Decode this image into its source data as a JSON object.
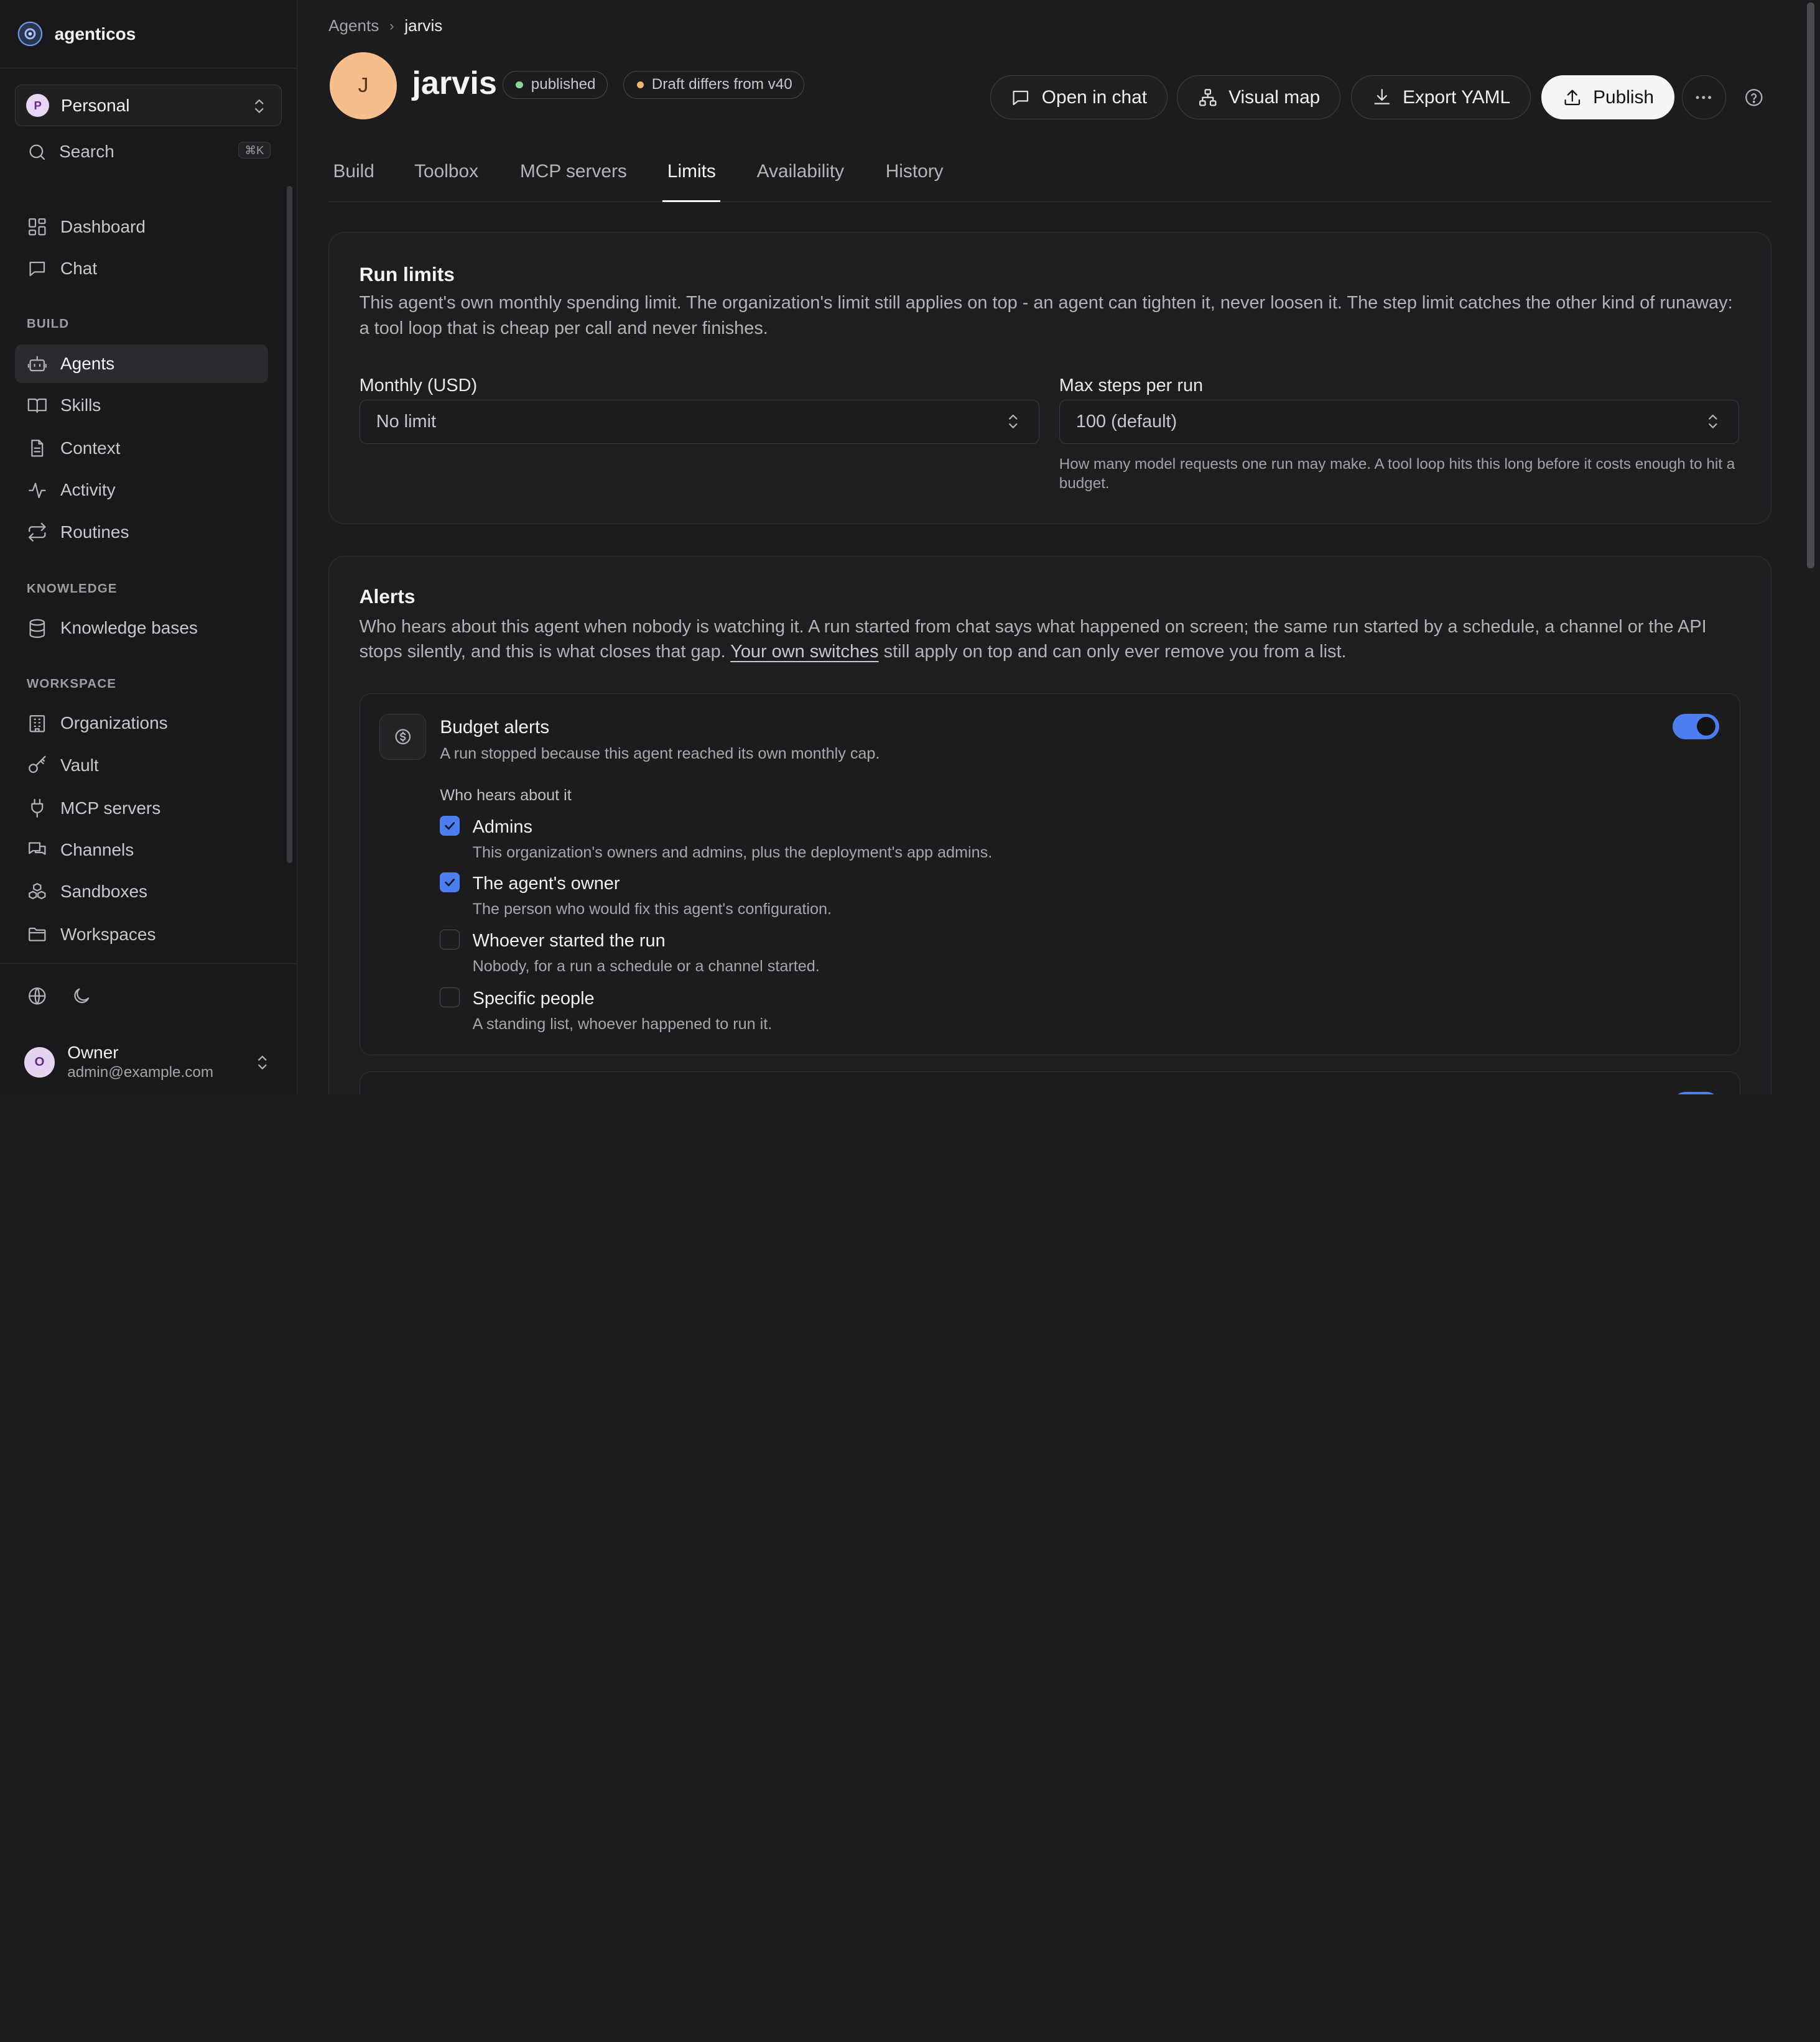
{
  "brand": {
    "name": "agenticos"
  },
  "workspace": {
    "avatar": "P",
    "name": "Personal"
  },
  "search": {
    "label": "Search",
    "shortcut": "⌘K"
  },
  "nav": {
    "top": [
      {
        "label": "Dashboard",
        "icon": "dashboard-icon"
      },
      {
        "label": "Chat",
        "icon": "chat-icon"
      }
    ],
    "build_label": "BUILD",
    "build": [
      {
        "label": "Agents",
        "icon": "bot-icon",
        "active": true
      },
      {
        "label": "Skills",
        "icon": "book-icon"
      },
      {
        "label": "Context",
        "icon": "file-icon"
      },
      {
        "label": "Activity",
        "icon": "activity-icon"
      },
      {
        "label": "Routines",
        "icon": "repeat-icon"
      }
    ],
    "knowledge_label": "KNOWLEDGE",
    "knowledge": [
      {
        "label": "Knowledge bases",
        "icon": "database-icon"
      }
    ],
    "workspace_label": "WORKSPACE",
    "workspace": [
      {
        "label": "Organizations",
        "icon": "building-icon"
      },
      {
        "label": "Vault",
        "icon": "key-icon"
      },
      {
        "label": "MCP servers",
        "icon": "plug-icon"
      },
      {
        "label": "Channels",
        "icon": "messages-icon"
      },
      {
        "label": "Sandboxes",
        "icon": "boxes-icon"
      },
      {
        "label": "Workspaces",
        "icon": "folder-icon"
      }
    ]
  },
  "user": {
    "avatar": "O",
    "name": "Owner",
    "email": "admin@example.com"
  },
  "breadcrumb": {
    "parent": "Agents",
    "current": "jarvis"
  },
  "agent": {
    "avatar": "J",
    "name": "jarvis",
    "status_badge": "published",
    "draft_badge": "Draft differs from v40",
    "status_color": "#8fd19e",
    "draft_color": "#f2b56b"
  },
  "actions": {
    "open_chat": "Open in chat",
    "visual_map": "Visual map",
    "export_yaml": "Export YAML",
    "publish": "Publish"
  },
  "tabs": [
    {
      "label": "Build"
    },
    {
      "label": "Toolbox"
    },
    {
      "label": "MCP servers"
    },
    {
      "label": "Limits",
      "active": true
    },
    {
      "label": "Availability"
    },
    {
      "label": "History"
    }
  ],
  "run_limits": {
    "title": "Run limits",
    "description": "This agent's own monthly spending limit. The organization's limit still applies on top - an agent can tighten it, never loosen it. The step limit catches the other kind of runaway: a tool loop that is cheap per call and never finishes.",
    "monthly_label": "Monthly (USD)",
    "monthly_placeholder": "No limit",
    "steps_label": "Max steps per run",
    "steps_placeholder": "100 (default)",
    "steps_help": "How many model requests one run may make. A tool loop hits this long before it costs enough to hit a budget."
  },
  "alerts": {
    "title": "Alerts",
    "description_pre": "Who hears about this agent when nobody is watching it. A run started from chat says what happened on screen; the same run started by a schedule, a channel or the API stops silently, and this is what closes that gap.",
    "description_link": "Your own switches",
    "description_post": "still apply on top and can only ever remove you from a list.",
    "budget": {
      "title": "Budget alerts",
      "subtitle": "A run stopped because this agent reached its own monthly cap.",
      "enabled": true,
      "who_label": "Who hears about it",
      "options": [
        {
          "title": "Admins",
          "subtitle": "This organization's owners and admins, plus the deployment's app admins.",
          "checked": true
        },
        {
          "title": "The agent's owner",
          "subtitle": "The person who would fix this agent's configuration.",
          "checked": true
        },
        {
          "title": "Whoever started the run",
          "subtitle": "Nobody, for a run a schedule or a channel started.",
          "checked": false
        },
        {
          "title": "Specific people",
          "subtitle": "A standing list, whoever happened to run it.",
          "checked": false
        }
      ]
    }
  },
  "accent_color": "#4c7ef0"
}
